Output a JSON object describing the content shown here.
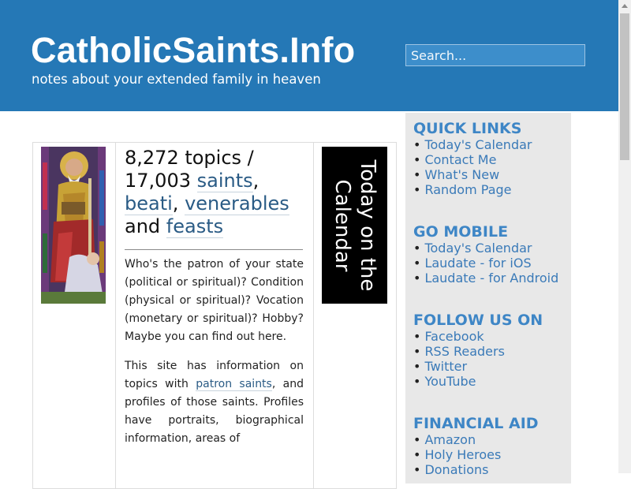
{
  "header": {
    "title": "CatholicSaints.Info",
    "tagline": "notes about your extended family in heaven",
    "search_placeholder": "Search..."
  },
  "main": {
    "topics_line": "8,272 topics /",
    "saints_count": "17,003",
    "saints_link": "saints",
    "beati_link": "beati",
    "venerables_link": "venerables",
    "and_text": "and",
    "feasts_link": "feasts",
    "intro_paragraph_1": "Who's the patron of your state (political or spiritual)? Condition (physical or spiritual)? Vocation (monetary or spiritual)? Hobby? Maybe you can find out here.",
    "intro_p2_part1": "This site has information on topics with",
    "patron_saints_link": "patron saints",
    "intro_p2_part2": ", and profiles of those saints. Profiles have portraits, biographical information, areas of",
    "today_banner": "Today on the Calendar"
  },
  "sidebar": {
    "quick_links": {
      "heading": "QUICK LINKS",
      "items": [
        "Today's Calendar",
        "Contact Me",
        "What's New",
        "Random Page"
      ]
    },
    "go_mobile": {
      "heading": "GO MOBILE",
      "items": [
        "Today's Calendar",
        "Laudate - for iOS",
        "Laudate - for Android"
      ]
    },
    "follow_us": {
      "heading": "FOLLOW US ON",
      "items": [
        "Facebook",
        "RSS Readers",
        "Twitter",
        "YouTube"
      ]
    },
    "financial_aid": {
      "heading": "FINANCIAL AID",
      "items": [
        "Amazon",
        "Holy Heroes",
        "Donations"
      ]
    }
  },
  "colors": {
    "header_bg": "#2578b6",
    "link": "#2a5b85",
    "sidebar_heading": "#3e86c6",
    "sidebar_link": "#3a7ab8",
    "sidebar_bg": "#e8e8e8"
  }
}
